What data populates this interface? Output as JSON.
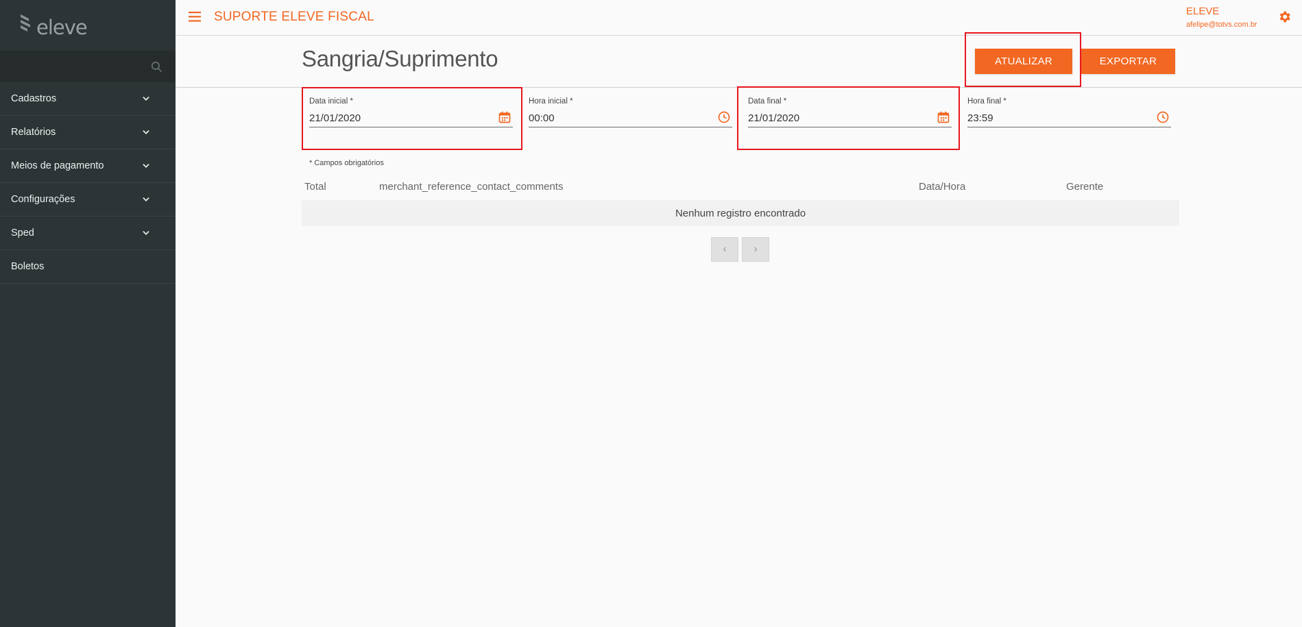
{
  "sidebar": {
    "logo_text": "eleve",
    "search_placeholder": "",
    "items": [
      {
        "label": "Cadastros",
        "expandable": true
      },
      {
        "label": "Relatórios",
        "expandable": true
      },
      {
        "label": "Meios de pagamento",
        "expandable": true
      },
      {
        "label": "Configurações",
        "expandable": true
      },
      {
        "label": "Sped",
        "expandable": true
      },
      {
        "label": "Boletos",
        "expandable": false
      }
    ]
  },
  "header": {
    "title": "SUPORTE ELEVE FISCAL",
    "user_name": "ELEVE",
    "user_email": "afelipe@totvs.com.br"
  },
  "page": {
    "title": "Sangria/Suprimento",
    "buttons": {
      "update": "ATUALIZAR",
      "export": "EXPORTAR"
    },
    "fields": {
      "start_date": {
        "label": "Data inicial *",
        "value": "21/01/2020"
      },
      "start_time": {
        "label": "Hora inicial *",
        "value": "00:00"
      },
      "end_date": {
        "label": "Data final *",
        "value": "21/01/2020"
      },
      "end_time": {
        "label": "Hora final *",
        "value": "23:59"
      }
    },
    "required_note": "* Campos obrigatórios",
    "table": {
      "columns": [
        "Total",
        "merchant_reference_contact_comments",
        "Data/Hora",
        "Gerente"
      ],
      "empty_message": "Nenhum registro encontrado"
    },
    "pagination": {
      "prev": "‹",
      "next": "›"
    }
  },
  "colors": {
    "accent": "#f26722",
    "sidebar_bg": "#2d3436",
    "highlight": "#e8161d"
  }
}
